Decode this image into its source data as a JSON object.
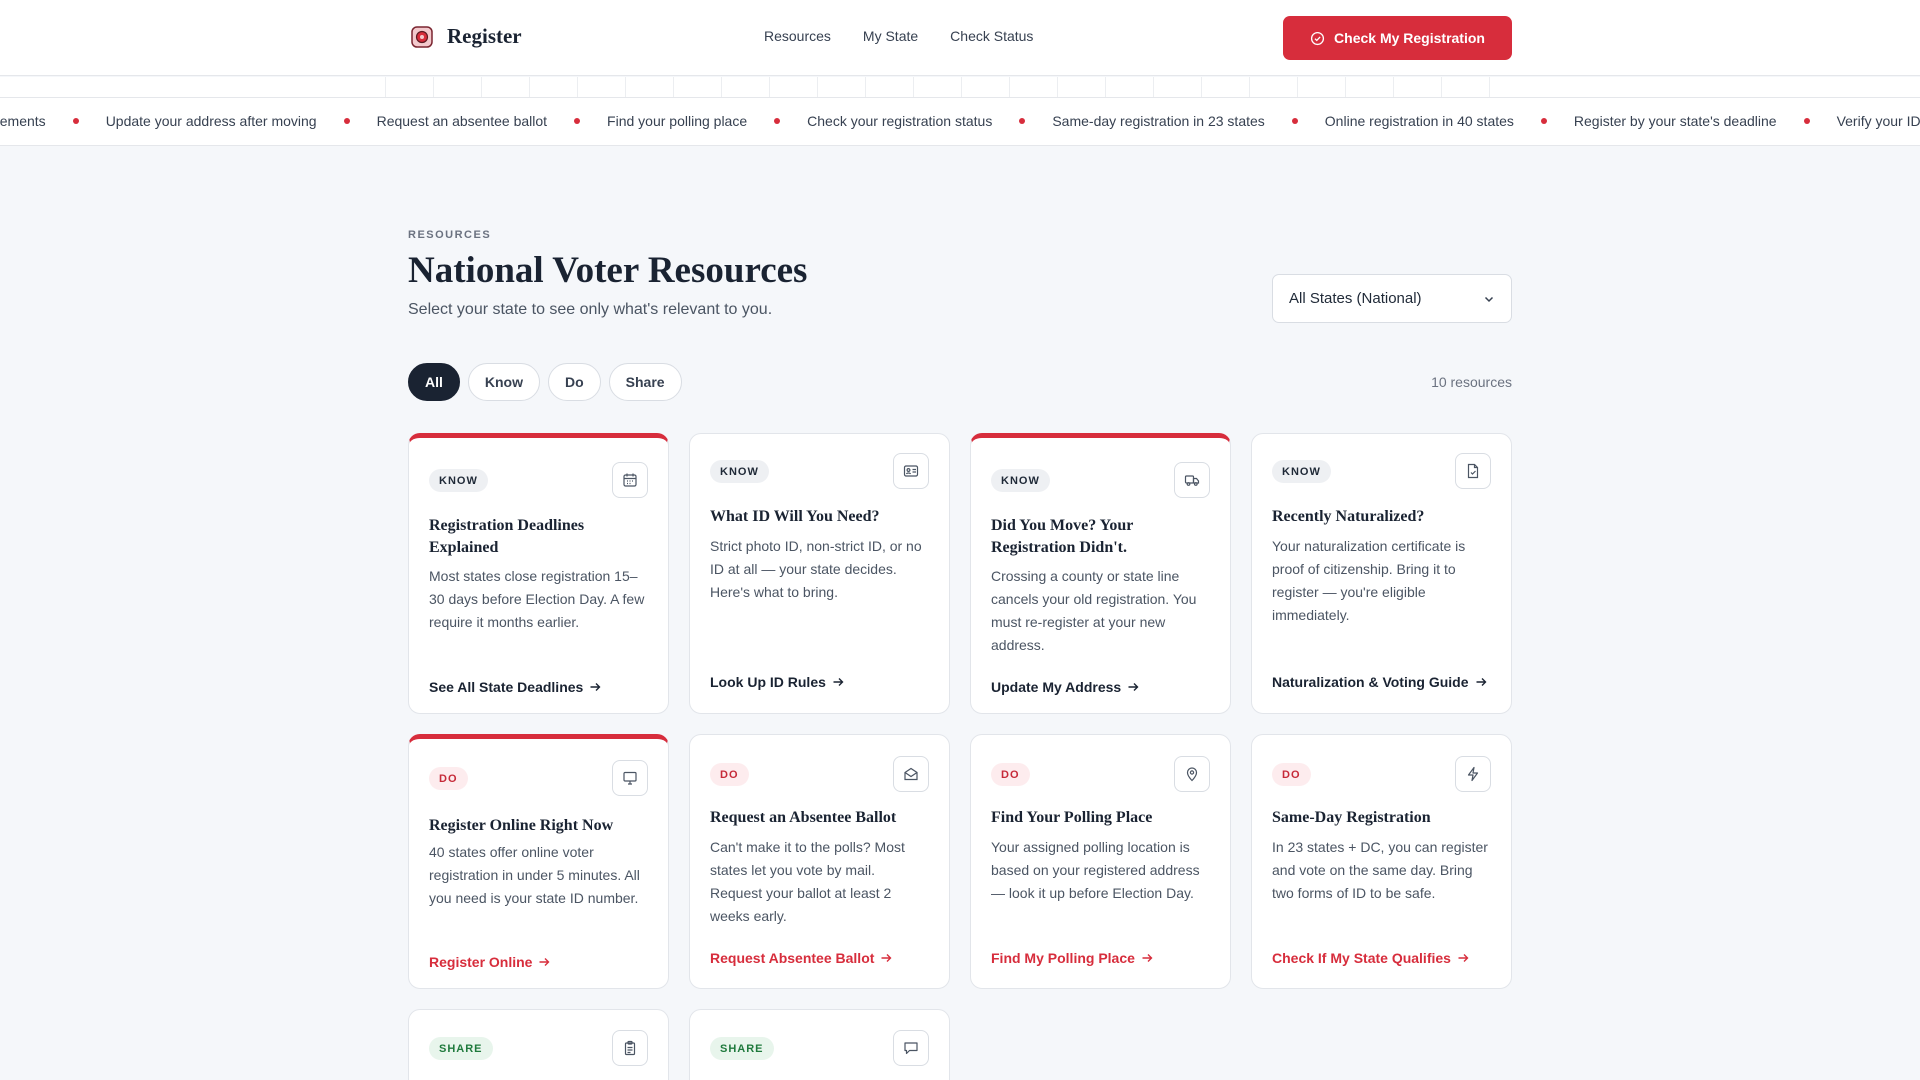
{
  "header": {
    "brand": "Register",
    "nav": [
      "Resources",
      "My State",
      "Check Status"
    ],
    "cta": "Check My Registration"
  },
  "ticker": [
    "irements",
    "Update your address after moving",
    "Request an absentee ballot",
    "Find your polling place",
    "Check your registration status",
    "Same-day registration in 23 states",
    "Online registration in 40 states",
    "Register by your state's deadline",
    "Verify your ID"
  ],
  "section": {
    "eyebrow": "RESOURCES",
    "title": "National Voter Resources",
    "subtitle": "Select your state to see only what's relevant to you.",
    "state_select": "All States (National)",
    "filters": [
      "All",
      "Know",
      "Do",
      "Share"
    ],
    "active_filter": "All",
    "count": "10 resources"
  },
  "cards": [
    {
      "tag": "KNOW",
      "icon": "calendar-icon",
      "title": "Registration Deadlines Explained",
      "desc": "Most states close registration 15–30 days before Election Day. A few require it months earlier.",
      "link": "See All State Deadlines"
    },
    {
      "tag": "KNOW",
      "icon": "id-card-icon",
      "title": "What ID Will You Need?",
      "desc": "Strict photo ID, non-strict ID, or no ID at all — your state decides. Here's what to bring.",
      "link": "Look Up ID Rules"
    },
    {
      "tag": "KNOW",
      "icon": "truck-icon",
      "title": "Did You Move? Your Registration Didn't.",
      "desc": "Crossing a county or state line cancels your old registration. You must re-register at your new address.",
      "link": "Update My Address"
    },
    {
      "tag": "KNOW",
      "icon": "document-icon",
      "title": "Recently Naturalized?",
      "desc": "Your naturalization certificate is proof of citizenship. Bring it to register — you're eligible immediately.",
      "link": "Naturalization & Voting Guide"
    },
    {
      "tag": "DO",
      "icon": "monitor-icon",
      "title": "Register Online Right Now",
      "desc": "40 states offer online voter registration in under 5 minutes. All you need is your state ID number.",
      "link": "Register Online"
    },
    {
      "tag": "DO",
      "icon": "mail-icon",
      "title": "Request an Absentee Ballot",
      "desc": "Can't make it to the polls? Most states let you vote by mail. Request your ballot at least 2 weeks early.",
      "link": "Request Absentee Ballot"
    },
    {
      "tag": "DO",
      "icon": "map-pin-icon",
      "title": "Find Your Polling Place",
      "desc": "Your assigned polling location is based on your registered address — look it up before Election Day.",
      "link": "Find My Polling Place"
    },
    {
      "tag": "DO",
      "icon": "lightning-icon",
      "title": "Same-Day Registration",
      "desc": "In 23 states + DC, you can register and vote on the same day. Bring two forms of ID to be safe.",
      "link": "Check If My State Qualifies"
    },
    {
      "tag": "SHARE",
      "icon": "clipboard-icon"
    },
    {
      "tag": "SHARE",
      "icon": "chat-icon"
    }
  ],
  "colors": {
    "accent": "#d72d3c",
    "navy": "#1a2332",
    "background": "#f5f7fa"
  }
}
